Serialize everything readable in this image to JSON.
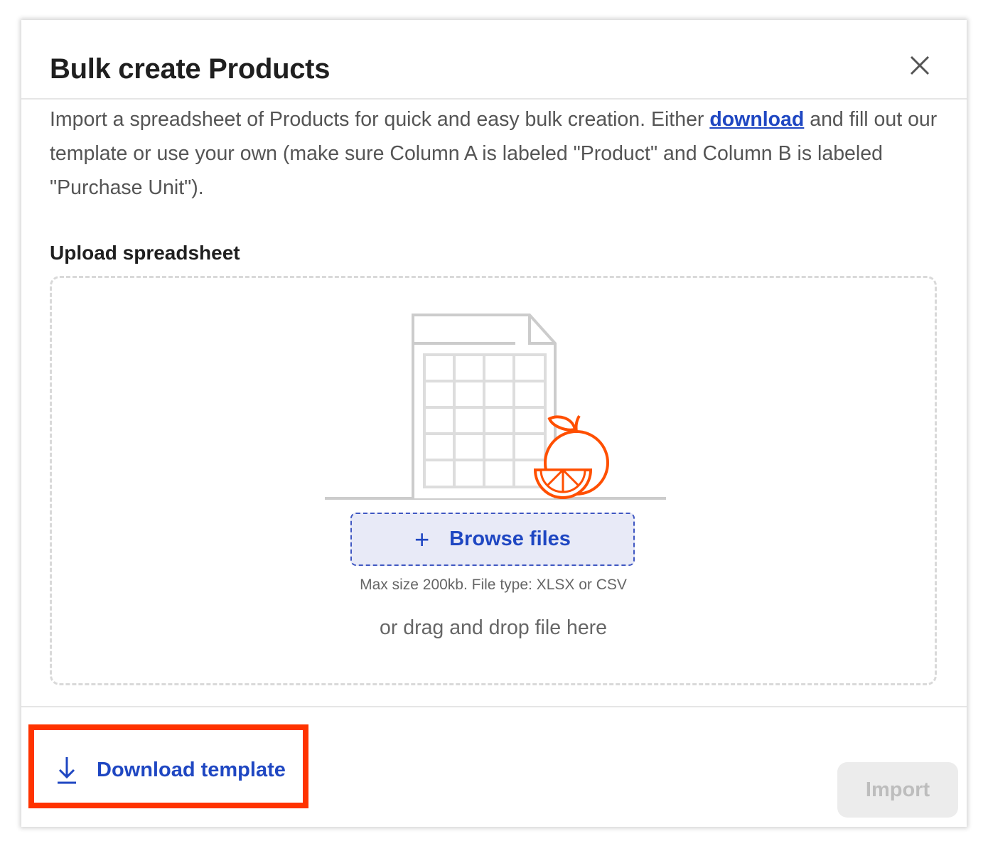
{
  "modal": {
    "title": "Bulk create Products",
    "description_before_link": "Import a spreadsheet of Products for quick and easy bulk creation. Either ",
    "description_link": "download",
    "description_after_link": " and fill out our template or use your own (make sure Column A is labeled \"Product\" and Column B is labeled \"Purchase Unit\")."
  },
  "upload": {
    "label": "Upload spreadsheet",
    "browse_icon": "+",
    "browse_label": "Browse files",
    "hint": "Max size 200kb. File type: XLSX or CSV",
    "drag_text": "or drag and drop file here",
    "illustration": "spreadsheet-with-orange-icon"
  },
  "footer": {
    "download_label": "Download template",
    "download_icon": "download-arrow-icon",
    "import_label": "Import",
    "import_disabled": true
  },
  "colors": {
    "accent": "#1f47c2",
    "highlight": "#ff3300",
    "orange": "#ff4f00"
  }
}
